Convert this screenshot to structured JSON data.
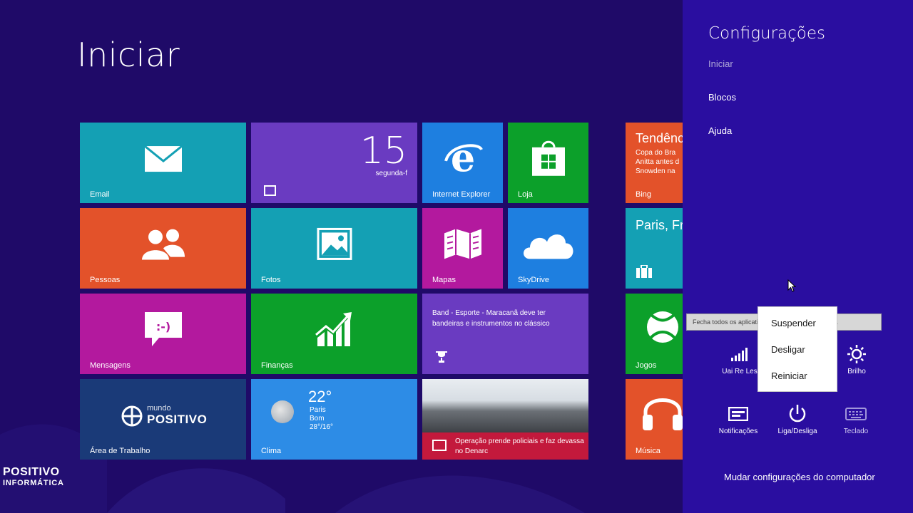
{
  "start": {
    "title": "Iniciar"
  },
  "tiles": {
    "email": {
      "label": "Email"
    },
    "calendar": {
      "day": "15",
      "weekday": "segunda-f"
    },
    "ie": {
      "label": "Internet Explorer"
    },
    "loja": {
      "label": "Loja"
    },
    "bing": {
      "title": "Tendênc",
      "lines": [
        "Copa do Bra",
        "Anitta antes d",
        "Snowden na"
      ],
      "label": "Bing"
    },
    "pessoas": {
      "label": "Pessoas"
    },
    "fotos": {
      "label": "Fotos"
    },
    "mapas": {
      "label": "Mapas"
    },
    "skydrive": {
      "label": "SkyDrive"
    },
    "viagens": {
      "title": "Paris, Fr"
    },
    "mensagens": {
      "label": "Mensagens"
    },
    "financas": {
      "label": "Finanças"
    },
    "esporte": {
      "text": "Band - Esporte - Maracanã deve ter bandeiras e instrumentos no clássico"
    },
    "jogos": {
      "label": "Jogos"
    },
    "desktop": {
      "logo_small": "mundo",
      "logo_big": "POSITIVO",
      "label": "Área de Trabalho"
    },
    "clima": {
      "temp": "22°",
      "city": "Paris",
      "condition": "Bom",
      "range": "28°/16°",
      "label": "Clima"
    },
    "noticias": {
      "text": "Operação prende policiais e faz devassa no Denarc"
    },
    "musica": {
      "label": "Música"
    }
  },
  "watermark": {
    "line1": "POSITIVO",
    "line2": "INFORMÁTICA"
  },
  "settings": {
    "title": "Configurações",
    "items": [
      "Iniciar",
      "Blocos",
      "Ajuda"
    ],
    "quick": {
      "network": "Uai Re Les",
      "brightness": "Brilho",
      "notifications": "Notificações",
      "power": "Liga/Desliga",
      "keyboard": "Teclado"
    },
    "change_link": "Mudar configurações do computador"
  },
  "tooltip": "Fecha todos os aplicativos e desliga o computador.",
  "power_menu": {
    "options": [
      "Suspender",
      "Desligar",
      "Reiniciar"
    ]
  },
  "colors": {
    "background": "#1f0a68",
    "charms": "#2a0ea0",
    "teal": "#14a0b4",
    "orange": "#e3522a",
    "green": "#0ca02a",
    "blue": "#1e7fe0",
    "magenta": "#b3199e",
    "purple": "#6a3bc1",
    "red": "#c3193c"
  }
}
